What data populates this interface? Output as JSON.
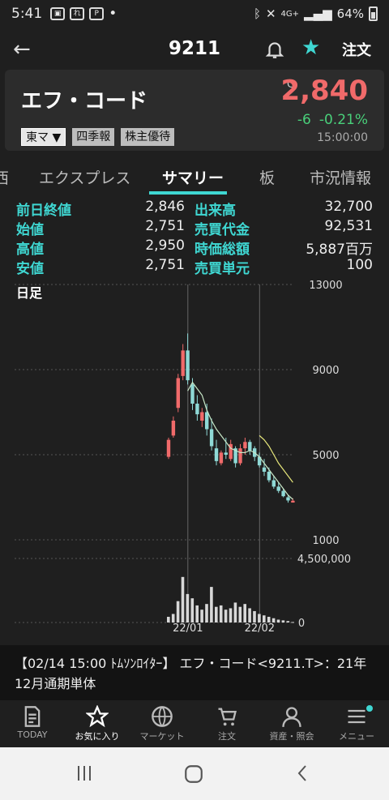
{
  "status": {
    "time": "5:41",
    "battery": "64%",
    "network": "4G+"
  },
  "header": {
    "code": "9211",
    "order_label": "注文"
  },
  "stock": {
    "name": "エフ・コード",
    "price_prefix": "C",
    "price": "2,840",
    "change": "-6",
    "change_pct": "-0.21%",
    "time": "15:00:00",
    "tags": [
      "東マ ▼",
      "四季報",
      "株主優待"
    ]
  },
  "tabs": [
    "西",
    "エクスプレス",
    "サマリー",
    "板",
    "市況情報"
  ],
  "stats": [
    {
      "l1": "前日終値",
      "v1": "2,846",
      "l2": "出来高",
      "v2": "32,700"
    },
    {
      "l1": "始値",
      "v1": "2,751",
      "l2": "売買代金",
      "v2": "92,531"
    },
    {
      "l1": "高値",
      "v1": "2,950",
      "l2": "時価総額",
      "v2": "5,887百万"
    },
    {
      "l1": "安値",
      "v1": "2,751",
      "l2": "売買単元",
      "v2": "100"
    }
  ],
  "chart_data": {
    "type": "candlestick",
    "title": "日足",
    "price_axis": {
      "min": 1000,
      "max": 13000,
      "ticks": [
        "13000",
        "9000",
        "5000",
        "1000"
      ]
    },
    "volume_axis": {
      "max": 4500000,
      "ticks": [
        "4,500,000",
        "0"
      ]
    },
    "x_ticks": [
      "22/01",
      "22/02"
    ],
    "candles": [
      {
        "o": 4900,
        "h": 5800,
        "l": 4800,
        "c": 5700
      },
      {
        "o": 5900,
        "h": 6800,
        "l": 5800,
        "c": 6600
      },
      {
        "o": 7200,
        "h": 8800,
        "l": 7000,
        "c": 8600
      },
      {
        "o": 8700,
        "h": 10200,
        "l": 8500,
        "c": 9900
      },
      {
        "o": 9900,
        "h": 10700,
        "l": 8300,
        "c": 8500
      },
      {
        "o": 8300,
        "h": 8600,
        "l": 7100,
        "c": 7400
      },
      {
        "o": 7400,
        "h": 7800,
        "l": 6600,
        "c": 6900
      },
      {
        "o": 6600,
        "h": 7200,
        "l": 6300,
        "c": 7000
      },
      {
        "o": 7000,
        "h": 7400,
        "l": 5900,
        "c": 6200
      },
      {
        "o": 6200,
        "h": 6700,
        "l": 5200,
        "c": 5400
      },
      {
        "o": 5300,
        "h": 5700,
        "l": 4500,
        "c": 4700
      },
      {
        "o": 4600,
        "h": 5200,
        "l": 4500,
        "c": 5100
      },
      {
        "o": 5100,
        "h": 5800,
        "l": 4800,
        "c": 5000
      },
      {
        "o": 4800,
        "h": 5700,
        "l": 4700,
        "c": 5500
      },
      {
        "o": 5300,
        "h": 5400,
        "l": 4400,
        "c": 4600
      },
      {
        "o": 4600,
        "h": 5500,
        "l": 4500,
        "c": 5300
      },
      {
        "o": 5300,
        "h": 5800,
        "l": 5000,
        "c": 5600
      },
      {
        "o": 5600,
        "h": 5700,
        "l": 5000,
        "c": 5200
      },
      {
        "o": 5300,
        "h": 5400,
        "l": 4700,
        "c": 4900
      },
      {
        "o": 4900,
        "h": 5100,
        "l": 4400,
        "c": 4500
      },
      {
        "o": 4400,
        "h": 4800,
        "l": 4000,
        "c": 4200
      },
      {
        "o": 4200,
        "h": 4400,
        "l": 3700,
        "c": 3800
      },
      {
        "o": 3800,
        "h": 4000,
        "l": 3400,
        "c": 3500
      },
      {
        "o": 3500,
        "h": 3700,
        "l": 3200,
        "c": 3300
      },
      {
        "o": 3300,
        "h": 3400,
        "l": 3000,
        "c": 3050
      },
      {
        "o": 3000,
        "h": 3100,
        "l": 2750,
        "c": 2850
      },
      {
        "o": 2751,
        "h": 2950,
        "l": 2751,
        "c": 2840
      }
    ],
    "volume": [
      400000,
      600000,
      1500000,
      3200000,
      2000000,
      1700000,
      1200000,
      900000,
      1300000,
      2500000,
      1100000,
      1200000,
      900000,
      1000000,
      1400000,
      1100000,
      1300000,
      1000000,
      800000,
      600000,
      500000,
      400000,
      300000,
      200000,
      150000,
      100000,
      32700
    ],
    "ma_short": [
      null,
      null,
      null,
      null,
      8000,
      8400,
      8100,
      7800,
      7100,
      6600,
      6200,
      5900,
      5600,
      5300,
      5200,
      5100,
      5100,
      5200,
      5100,
      4900,
      4600,
      4300,
      4000,
      3700,
      3400,
      3100,
      2900
    ],
    "ma_long": [
      null,
      null,
      null,
      null,
      null,
      null,
      null,
      null,
      null,
      null,
      null,
      null,
      null,
      null,
      null,
      null,
      null,
      null,
      null,
      5900,
      5700,
      5400,
      5000,
      4600,
      4300,
      4000,
      3700
    ]
  },
  "news": {
    "text": "【02/14 15:00 ﾄﾑｿﾝﾛｲﾀｰ】 エフ・コード<9211.T>：21年12月通期単体"
  },
  "nav": [
    {
      "label": "TODAY",
      "icon": "doc-icon"
    },
    {
      "label": "お気に入り",
      "icon": "star-icon"
    },
    {
      "label": "マーケット",
      "icon": "globe-icon"
    },
    {
      "label": "注文",
      "icon": "cart-icon"
    },
    {
      "label": "資産・照会",
      "icon": "person-icon"
    },
    {
      "label": "メニュー",
      "icon": "menu-icon"
    }
  ],
  "colors": {
    "accent": "#3fd7d2",
    "up": "#f06a6a",
    "down": "#49d07a",
    "candle_down": "#8fd9d6"
  }
}
